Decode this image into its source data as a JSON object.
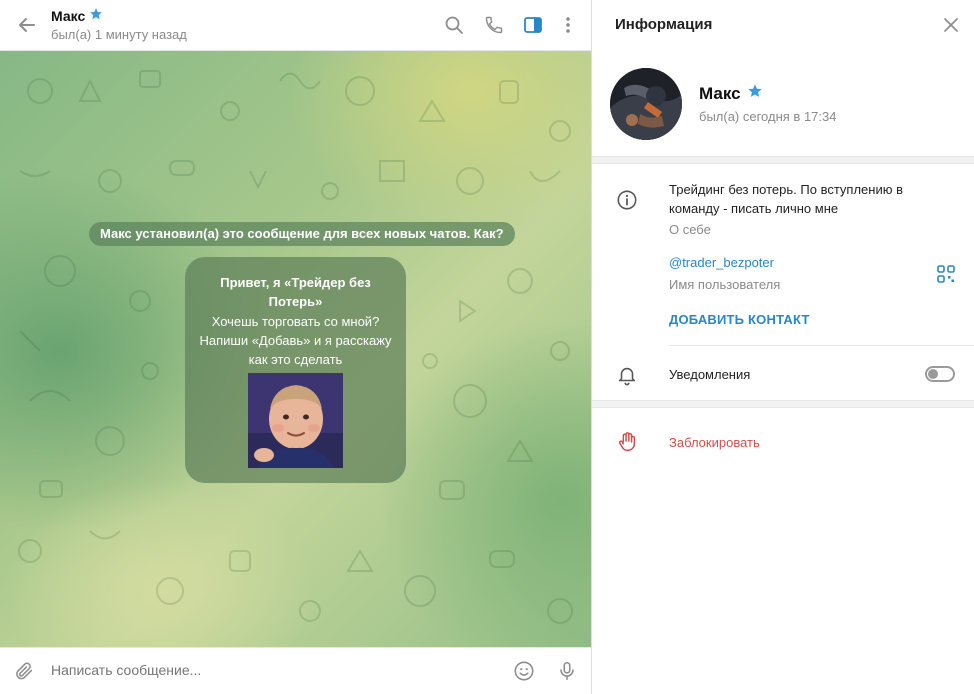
{
  "chat_header": {
    "peer_name": "Макс",
    "peer_status": "был(а) 1 минуту назад"
  },
  "chat": {
    "service_message": "Макс установил(а) это сообщение для всех новых чатов. Как?",
    "intro_title": "Привет, я «Трейдер без Потерь»",
    "intro_text": "Хочешь торговать со мной? Напиши «Добавь» и я расскажу как это сделать"
  },
  "composer": {
    "placeholder": "Написать сообщение..."
  },
  "info_panel": {
    "title": "Информация",
    "profile_name": "Макс",
    "profile_status": "был(а) сегодня в 17:34",
    "bio": "Трейдинг без потерь. По вступлению в команду - писать лично мне",
    "bio_label": "О себе",
    "username": "@trader_bezpoter",
    "username_label": "Имя пользователя",
    "add_contact": "ДОБАВИТЬ КОНТАКТ",
    "notifications_label": "Уведомления",
    "notifications_enabled": false,
    "block_label": "Заблокировать"
  },
  "colors": {
    "accent": "#2b86c5",
    "danger": "#d24d4d",
    "premium_star": "#3a9be0",
    "icon_gray": "#8d8d8d"
  },
  "icons": [
    "back-arrow-icon",
    "premium-star-icon",
    "search-icon",
    "phone-icon",
    "sidebar-panel-icon",
    "more-vertical-icon",
    "attach-icon",
    "emoji-icon",
    "microphone-icon",
    "close-icon",
    "info-icon",
    "qr-code-icon",
    "bell-icon",
    "hand-block-icon"
  ]
}
